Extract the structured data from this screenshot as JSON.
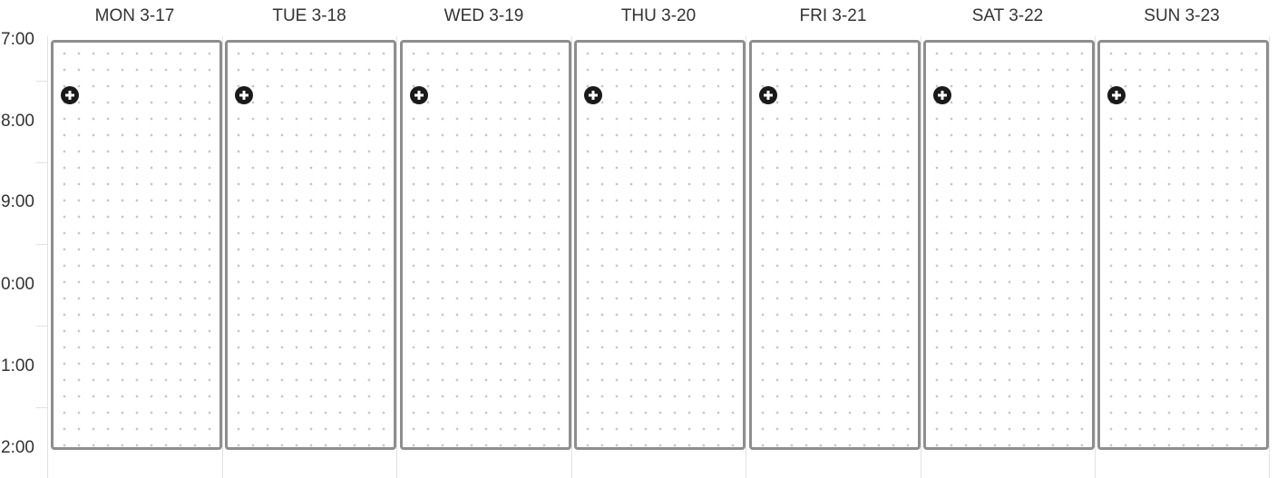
{
  "time_labels": [
    "7:00",
    "8:00",
    "9:00",
    "0:00",
    "1:00",
    "2:00"
  ],
  "days": [
    {
      "label": "MON 3-17"
    },
    {
      "label": "TUE 3-18"
    },
    {
      "label": "WED 3-19"
    },
    {
      "label": "THU 3-20"
    },
    {
      "label": "FRI 3-21"
    },
    {
      "label": "SAT 3-22"
    },
    {
      "label": "SUN 3-23"
    }
  ],
  "icons": {
    "add": "plus-circle-icon"
  },
  "colors": {
    "block_border": "#8e8e8e",
    "dot": "#c6c6c6",
    "icon": "#1a1a1a",
    "text": "#333333"
  }
}
